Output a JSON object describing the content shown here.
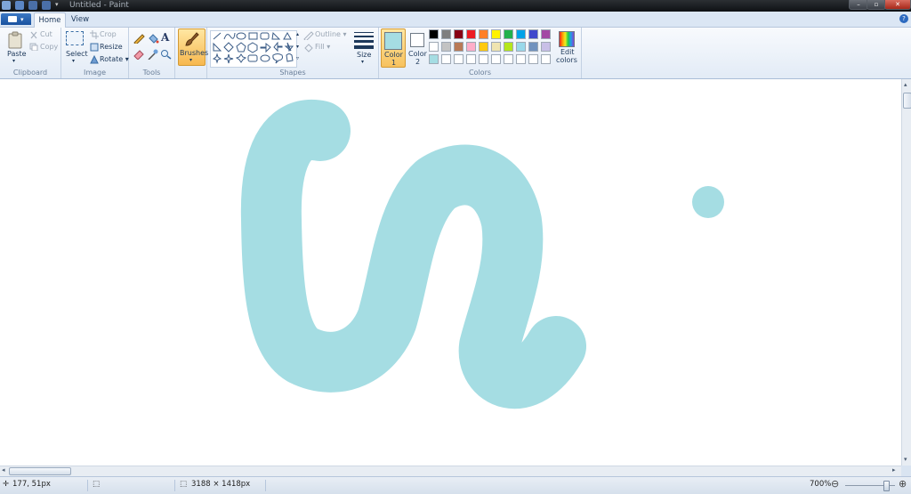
{
  "window": {
    "title": "Untitled - Paint"
  },
  "tabs": {
    "home": "Home",
    "view": "View"
  },
  "clipboard": {
    "paste": "Paste",
    "cut": "Cut",
    "copy": "Copy",
    "label": "Clipboard"
  },
  "image": {
    "select": "Select",
    "crop": "Crop",
    "resize": "Resize",
    "rotate": "Rotate",
    "label": "Image"
  },
  "tools": {
    "label": "Tools"
  },
  "brushes": {
    "label": "Brushes"
  },
  "shapes": {
    "outline": "Outline",
    "fill": "Fill",
    "label": "Shapes"
  },
  "size": {
    "label": "Size"
  },
  "colors": {
    "color1_line1": "Color",
    "color1_line2": "1",
    "color2_line1": "Color",
    "color2_line2": "2",
    "edit_line1": "Edit",
    "edit_line2": "colors",
    "label": "Colors",
    "color1_value": "#a5dde3",
    "color2_value": "#ffffff",
    "palette_row1": [
      "#000000",
      "#7f7f7f",
      "#880015",
      "#ed1c24",
      "#ff7f27",
      "#fff200",
      "#22b14c",
      "#00a2e8",
      "#3f48cc",
      "#a349a4"
    ],
    "palette_row2": [
      "#ffffff",
      "#c3c3c3",
      "#b97a57",
      "#ffaec9",
      "#ffc90e",
      "#efe4b0",
      "#b5e61d",
      "#99d9ea",
      "#7092be",
      "#c8bfe7"
    ],
    "palette_row3": [
      "#a5dde3",
      "#ffffff",
      "#ffffff",
      "#ffffff",
      "#ffffff",
      "#ffffff",
      "#ffffff",
      "#ffffff",
      "#ffffff",
      "#ffffff"
    ]
  },
  "canvas": {
    "stroke_color": "#a5dde3"
  },
  "status": {
    "cursor_pos": "177, 51px",
    "canvas_size": "3188 × 1418px",
    "zoom": "700%"
  }
}
